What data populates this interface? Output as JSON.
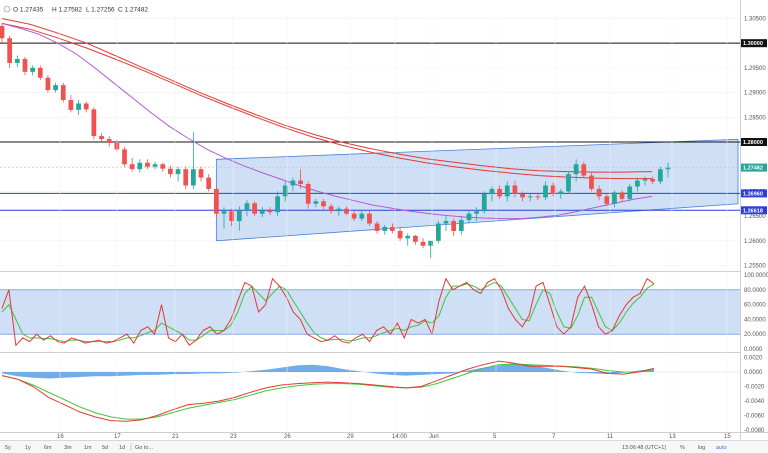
{
  "header": {
    "open": "O 1.27435",
    "high": "H 1.27582",
    "low": "L 1.27256",
    "close": "C 1.27482"
  },
  "toolbar": {
    "timeframes": [
      "5y",
      "1y",
      "6m",
      "3m",
      "1m",
      "5d",
      "1d",
      "Go to..."
    ],
    "clock": "13:06:48 (UTC+1)",
    "pct": "%",
    "log": "log",
    "auto": "auto"
  },
  "colors": {
    "bull": "#26a69a",
    "bear": "#ef5350",
    "channel_fill": "#c6d9f5",
    "channel_line": "#4a7fd6",
    "ma_fast": "#b65ad6",
    "ma_slow": "#e53935",
    "support": "#2e3fd8",
    "resistance": "#111111",
    "stoch_k": "#e53935",
    "stoch_d": "#43c43a",
    "hist": "#5b9ee6"
  },
  "chart_data": [
    {
      "type": "line",
      "title": "",
      "ylim": [
        1.2545,
        1.3055
      ],
      "x_ticks": [
        "16",
        "17",
        "21",
        "23",
        "26",
        "29",
        "14:00",
        "Jun",
        "5",
        "7",
        "11",
        "13",
        "15"
      ],
      "y_ticks": [
        "1.30500",
        "1.30000",
        "1.29500",
        "1.29000",
        "1.28500",
        "1.28000",
        "1.27500",
        "1.27000",
        "1.26500",
        "1.26000",
        "1.25500"
      ],
      "price_tags": [
        "1.30000",
        "1.28000",
        "1.27482",
        "1.26960",
        "1.26618"
      ],
      "candles": [
        [
          1.3035,
          1.304,
          1.3,
          1.301
        ],
        [
          1.301,
          1.3015,
          1.295,
          1.296
        ],
        [
          1.296,
          1.2975,
          1.2952,
          1.2968
        ],
        [
          1.2968,
          1.2972,
          1.2935,
          1.2942
        ],
        [
          1.2942,
          1.2955,
          1.2935,
          1.295
        ],
        [
          1.295,
          1.2955,
          1.2925,
          1.293
        ],
        [
          1.293,
          1.2935,
          1.29,
          1.2905
        ],
        [
          1.2905,
          1.292,
          1.29,
          1.2915
        ],
        [
          1.2915,
          1.292,
          1.288,
          1.2885
        ],
        [
          1.2885,
          1.2895,
          1.286,
          1.2865
        ],
        [
          1.2865,
          1.2885,
          1.2855,
          1.2878
        ],
        [
          1.2878,
          1.2882,
          1.286,
          1.2866
        ],
        [
          1.2866,
          1.287,
          1.2805,
          1.2812
        ],
        [
          1.2812,
          1.2818,
          1.28,
          1.2806
        ],
        [
          1.2806,
          1.2812,
          1.279,
          1.2798
        ],
        [
          1.2798,
          1.2805,
          1.278,
          1.2785
        ],
        [
          1.2785,
          1.279,
          1.275,
          1.2755
        ],
        [
          1.2755,
          1.2768,
          1.274,
          1.2745
        ],
        [
          1.2745,
          1.2765,
          1.2738,
          1.2758
        ],
        [
          1.2758,
          1.2765,
          1.2745,
          1.275
        ],
        [
          1.275,
          1.276,
          1.2745,
          1.2755
        ],
        [
          1.2755,
          1.2758,
          1.274,
          1.2746
        ],
        [
          1.2746,
          1.2752,
          1.2728,
          1.2735
        ],
        [
          1.2735,
          1.275,
          1.272,
          1.2745
        ],
        [
          1.2745,
          1.275,
          1.2705,
          1.2712
        ],
        [
          1.2712,
          1.282,
          1.2705,
          1.2745
        ],
        [
          1.2745,
          1.275,
          1.272,
          1.2728
        ],
        [
          1.2728,
          1.2735,
          1.27,
          1.2705
        ],
        [
          1.2705,
          1.2712,
          1.2645,
          1.2655
        ],
        [
          1.2655,
          1.2668,
          1.2625,
          1.266
        ],
        [
          1.266,
          1.2665,
          1.263,
          1.264
        ],
        [
          1.264,
          1.267,
          1.262,
          1.2662
        ],
        [
          1.2662,
          1.2682,
          1.265,
          1.2676
        ],
        [
          1.2676,
          1.268,
          1.265,
          1.2655
        ],
        [
          1.2655,
          1.2668,
          1.2648,
          1.2662
        ],
        [
          1.2662,
          1.2668,
          1.2652,
          1.2658
        ],
        [
          1.2658,
          1.27,
          1.265,
          1.269
        ],
        [
          1.269,
          1.272,
          1.268,
          1.2712
        ],
        [
          1.2712,
          1.2728,
          1.27,
          1.2722
        ],
        [
          1.2722,
          1.2745,
          1.2705,
          1.2715
        ],
        [
          1.2715,
          1.272,
          1.2665,
          1.2675
        ],
        [
          1.2675,
          1.2685,
          1.2668,
          1.268
        ],
        [
          1.268,
          1.2685,
          1.2664,
          1.267
        ],
        [
          1.267,
          1.2675,
          1.2655,
          1.266
        ],
        [
          1.266,
          1.267,
          1.265,
          1.2665
        ],
        [
          1.2665,
          1.267,
          1.2652,
          1.2655
        ],
        [
          1.2655,
          1.266,
          1.264,
          1.2645
        ],
        [
          1.2645,
          1.266,
          1.264,
          1.2655
        ],
        [
          1.2655,
          1.266,
          1.263,
          1.2635
        ],
        [
          1.2635,
          1.264,
          1.2615,
          1.262
        ],
        [
          1.262,
          1.2632,
          1.2612,
          1.2628
        ],
        [
          1.2628,
          1.2635,
          1.2615,
          1.262
        ],
        [
          1.262,
          1.2628,
          1.26,
          1.2605
        ],
        [
          1.2605,
          1.2615,
          1.259,
          1.261
        ],
        [
          1.261,
          1.2612,
          1.2592,
          1.2598
        ],
        [
          1.2598,
          1.2605,
          1.2585,
          1.259
        ],
        [
          1.259,
          1.2595,
          1.2565,
          1.26
        ],
        [
          1.26,
          1.264,
          1.2595,
          1.2635
        ],
        [
          1.2635,
          1.265,
          1.262,
          1.264
        ],
        [
          1.264,
          1.2645,
          1.261,
          1.262
        ],
        [
          1.262,
          1.2648,
          1.2612,
          1.2642
        ],
        [
          1.2642,
          1.266,
          1.2635,
          1.2655
        ],
        [
          1.2655,
          1.2668,
          1.264,
          1.266
        ],
        [
          1.266,
          1.27,
          1.2655,
          1.2695
        ],
        [
          1.2695,
          1.271,
          1.268,
          1.2705
        ],
        [
          1.2705,
          1.2712,
          1.2685,
          1.269
        ],
        [
          1.269,
          1.272,
          1.268,
          1.2712
        ],
        [
          1.2712,
          1.2722,
          1.2688,
          1.2695
        ],
        [
          1.2695,
          1.27,
          1.268,
          1.2688
        ],
        [
          1.2688,
          1.2695,
          1.268,
          1.269
        ],
        [
          1.269,
          1.2696,
          1.2682,
          1.2688
        ],
        [
          1.2688,
          1.272,
          1.2682,
          1.2712
        ],
        [
          1.2712,
          1.2718,
          1.269,
          1.2695
        ],
        [
          1.2695,
          1.2705,
          1.2685,
          1.27
        ],
        [
          1.27,
          1.274,
          1.2695,
          1.2735
        ],
        [
          1.2735,
          1.2765,
          1.272,
          1.2755
        ],
        [
          1.2755,
          1.276,
          1.2728,
          1.2732
        ],
        [
          1.2732,
          1.274,
          1.27,
          1.2705
        ],
        [
          1.2705,
          1.2712,
          1.2682,
          1.269
        ],
        [
          1.269,
          1.2695,
          1.267,
          1.2675
        ],
        [
          1.2675,
          1.2702,
          1.2668,
          1.2698
        ],
        [
          1.2698,
          1.2702,
          1.268,
          1.2685
        ],
        [
          1.2685,
          1.2715,
          1.268,
          1.271
        ],
        [
          1.271,
          1.2728,
          1.27,
          1.2722
        ],
        [
          1.2722,
          1.273,
          1.2712,
          1.2725
        ],
        [
          1.2725,
          1.273,
          1.2715,
          1.272
        ],
        [
          1.272,
          1.275,
          1.2715,
          1.2745
        ],
        [
          1.2745,
          1.2758,
          1.2728,
          1.2748
        ]
      ],
      "ma_fast": [
        1.304,
        1.303,
        1.3018,
        1.3,
        1.2978,
        1.295,
        1.292,
        1.289,
        1.286,
        1.2832,
        1.2808,
        1.2786,
        1.2768,
        1.2752,
        1.2738,
        1.2725,
        1.2712,
        1.27,
        1.269,
        1.2681,
        1.2672,
        1.2666,
        1.266,
        1.2655,
        1.2651,
        1.2648,
        1.2646,
        1.2645,
        1.2645,
        1.2648,
        1.2652,
        1.266,
        1.2668,
        1.2676,
        1.2684,
        1.269
      ],
      "ma_slow1": [
        1.305,
        1.3038,
        1.302,
        1.3,
        1.2975,
        1.295,
        1.2925,
        1.29,
        1.2877,
        1.2855,
        1.2834,
        1.2816,
        1.28,
        1.2787,
        1.2776,
        1.2766,
        1.2759,
        1.2752,
        1.2746,
        1.2742,
        1.274,
        1.2739,
        1.2739,
        1.274
      ],
      "ma_slow2": [
        1.304,
        1.3028,
        1.301,
        1.299,
        1.2968,
        1.2945,
        1.292,
        1.2895,
        1.2872,
        1.285,
        1.2829,
        1.281,
        1.2794,
        1.278,
        1.2768,
        1.2758,
        1.275,
        1.2743,
        1.2737,
        1.2732,
        1.2729,
        1.2727,
        1.2726,
        1.2726
      ],
      "channel": {
        "start_index": 28,
        "end_index": 87,
        "lower_start": 1.26,
        "lower_end": 1.2665,
        "upper_start": 1.2765,
        "upper_end": 1.28
      },
      "resistance": [
        1.3,
        1.28
      ],
      "support": [
        1.2696,
        1.2662
      ]
    },
    {
      "type": "line",
      "title": "",
      "ylim": [
        0,
        100
      ],
      "y_ticks": [
        "100.0000",
        "80.0000",
        "60.0000",
        "40.0000",
        "20.0000",
        "0.0000"
      ],
      "band": [
        20,
        80
      ],
      "series": [
        {
          "values": [
            55,
            80,
            5,
            15,
            10,
            20,
            12,
            18,
            10,
            8,
            15,
            12,
            8,
            10,
            12,
            8,
            10,
            15,
            20,
            8,
            25,
            30,
            20,
            60,
            15,
            10,
            20,
            5,
            12,
            25,
            30,
            20,
            25,
            40,
            65,
            90,
            85,
            50,
            60,
            95,
            85,
            70,
            50,
            40,
            20,
            15,
            10,
            12,
            18,
            10,
            8,
            15,
            20,
            10,
            25,
            30,
            20,
            35,
            15,
            40,
            35,
            40,
            20,
            65,
            95,
            80,
            85,
            90,
            80,
            75,
            90,
            95,
            80,
            55,
            40,
            30,
            45,
            85,
            90,
            60,
            30,
            20,
            30,
            70,
            85,
            60,
            30,
            20,
            25,
            45,
            60,
            70,
            75,
            95,
            88
          ]
        },
        {
          "values": [
            50,
            60,
            40,
            20,
            15,
            15,
            14,
            14,
            12,
            10,
            12,
            12,
            10,
            10,
            10,
            10,
            10,
            12,
            15,
            15,
            18,
            22,
            25,
            35,
            30,
            25,
            20,
            12,
            12,
            18,
            25,
            25,
            25,
            32,
            50,
            75,
            85,
            75,
            65,
            75,
            85,
            80,
            65,
            50,
            35,
            22,
            15,
            12,
            13,
            13,
            11,
            12,
            15,
            15,
            18,
            22,
            25,
            28,
            25,
            30,
            32,
            38,
            35,
            45,
            70,
            85,
            85,
            88,
            85,
            80,
            85,
            90,
            85,
            70,
            55,
            40,
            38,
            60,
            80,
            75,
            50,
            30,
            28,
            45,
            70,
            70,
            50,
            30,
            25,
            35,
            50,
            62,
            70,
            82,
            88
          ]
        }
      ]
    },
    {
      "type": "line",
      "title": "",
      "ylim": [
        -0.008,
        0.0022
      ],
      "y_ticks": [
        "0.0020",
        "0.0000",
        "-0.0020",
        "-0.0040",
        "-0.0060",
        "-0.0080"
      ],
      "histogram": [
        -0.0002,
        -0.0006,
        -0.0008,
        -0.0009,
        -0.0008,
        -0.0007,
        -0.0006,
        -0.0006,
        -0.0005,
        -0.0004,
        -0.0004,
        -0.0003,
        -0.0003,
        -0.0002,
        -0.0002,
        -0.0001,
        0.0001,
        0.0003,
        0.0006,
        0.0009,
        0.001,
        0.0008,
        0.0004,
        0.0001,
        -0.0002,
        -0.0004,
        -0.0005,
        -0.0004,
        -0.0003,
        -0.0002,
        0.0002,
        0.0006,
        0.0009,
        0.0011,
        0.001,
        0.0006,
        0.0002,
        -0.0001,
        -0.0002,
        -0.0003,
        -0.0001,
        0.0002,
        0.0004
      ],
      "series": [
        {
          "values": [
            -0.0005,
            -0.001,
            -0.002,
            -0.0035,
            -0.0045,
            -0.0055,
            -0.0062,
            -0.0067,
            -0.0068,
            -0.0066,
            -0.006,
            -0.0052,
            -0.0045,
            -0.0043,
            -0.004,
            -0.0035,
            -0.0028,
            -0.0022,
            -0.0018,
            -0.0016,
            -0.0015,
            -0.0014,
            -0.0015,
            -0.0016,
            -0.0018,
            -0.002,
            -0.0022,
            -0.002,
            -0.0012,
            -0.0004,
            0.0004,
            0.001,
            0.0015,
            0.0012,
            0.0008,
            0.0008,
            0.0008,
            0.0006,
            0.0004,
            -0.0002,
            -0.0003,
            0.0,
            0.0005
          ]
        },
        {
          "values": [
            -0.0005,
            -0.001,
            -0.0018,
            -0.0028,
            -0.0038,
            -0.0048,
            -0.0056,
            -0.0062,
            -0.0065,
            -0.0065,
            -0.0062,
            -0.0056,
            -0.005,
            -0.0046,
            -0.0042,
            -0.0038,
            -0.0032,
            -0.0026,
            -0.0022,
            -0.0019,
            -0.0017,
            -0.0016,
            -0.0016,
            -0.0017,
            -0.0019,
            -0.0021,
            -0.0022,
            -0.0021,
            -0.0016,
            -0.0009,
            -0.0002,
            0.0005,
            0.001,
            0.0011,
            0.001,
            0.0009,
            0.0008,
            0.0007,
            0.0005,
            0.0002,
            0.0,
            0.0,
            0.0003
          ]
        }
      ]
    }
  ]
}
